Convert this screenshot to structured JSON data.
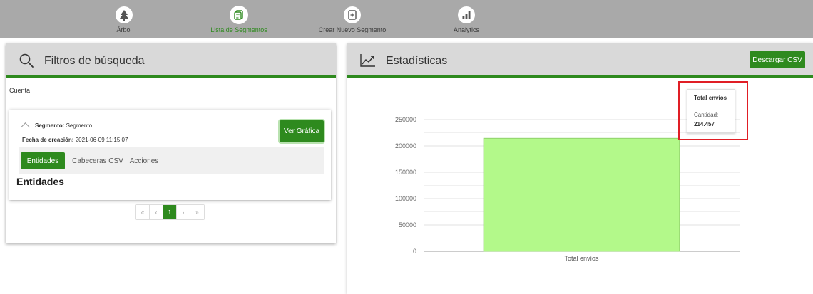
{
  "nav": {
    "items": [
      {
        "label": "Árbol",
        "icon": "tree-icon"
      },
      {
        "label": "Lista de Segmentos",
        "icon": "list-icon"
      },
      {
        "label": "Crear Nuevo Segmento",
        "icon": "add-segment-icon"
      },
      {
        "label": "Analytics",
        "icon": "bar-chart-icon"
      }
    ],
    "active_index": 1
  },
  "filters_panel": {
    "title": "Filtros de búsqueda",
    "account_label": "Cuenta"
  },
  "segment_card": {
    "segment_key": "Segmento:",
    "segment_value": "Segmento",
    "date_key": "Fecha de creación:",
    "date_value": "2021-06-09 11:15:07",
    "view_chart_label": "Ver Gráfica",
    "tabs": [
      "Entidades",
      "Cabeceras CSV",
      "Acciones"
    ],
    "active_tab": 0,
    "section_heading": "Entidades"
  },
  "pagination": {
    "first": "«",
    "prev": "‹",
    "current": "1",
    "next": "›",
    "last": "»"
  },
  "stats_panel": {
    "title": "Estadísticas",
    "download_label": "Descargar CSV"
  },
  "chart_data": {
    "type": "bar",
    "categories": [
      "Total envíos"
    ],
    "values": [
      214457
    ],
    "ylim": [
      0,
      250000
    ],
    "yticks": [
      0,
      50000,
      100000,
      150000,
      200000,
      250000
    ],
    "grid": true,
    "bar_color": "#b3f98a",
    "bar_border": "#8fcf6b",
    "tooltip": {
      "title": "Total envíos",
      "label": "Cantidad:",
      "value": "214.457"
    }
  },
  "colors": {
    "accent": "#2e8a1e",
    "nav_bg": "#a9a9a9",
    "highlight": "#e01e25"
  }
}
